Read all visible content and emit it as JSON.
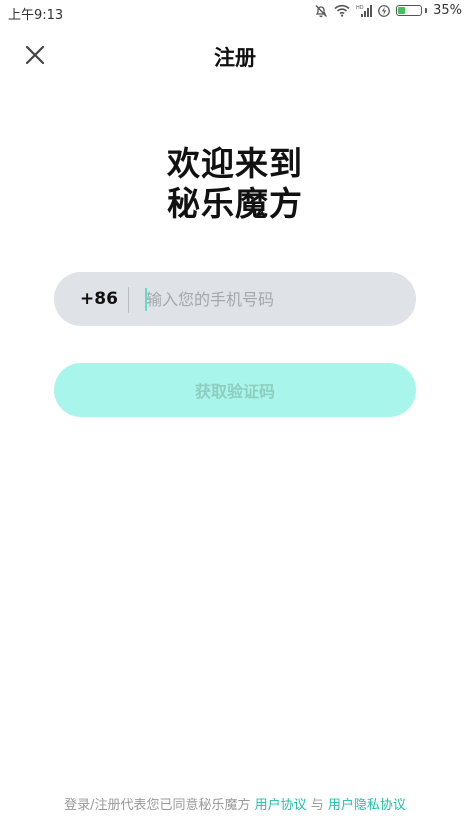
{
  "status_bar": {
    "time": "上午9:13",
    "battery_percent_label": "35%",
    "battery_level": 0.35,
    "network_label": "HD"
  },
  "header": {
    "title": "注册",
    "close_icon": "close-icon"
  },
  "welcome": {
    "line1": "欢迎来到",
    "line2": "秘乐魔方"
  },
  "phone": {
    "country_code": "+86",
    "placeholder": "输入您的手机号码",
    "value": ""
  },
  "buttons": {
    "get_code": "获取验证码"
  },
  "agreement": {
    "prefix": "登录/注册代表您已同意秘乐魔方",
    "user_agreement": "用户协议",
    "conjunction": "与",
    "privacy_agreement": "用户隐私协议"
  },
  "colors": {
    "accent": "#1fc3a6",
    "button_bg": "#a8f5eb",
    "input_bg": "#dfe2e6"
  }
}
